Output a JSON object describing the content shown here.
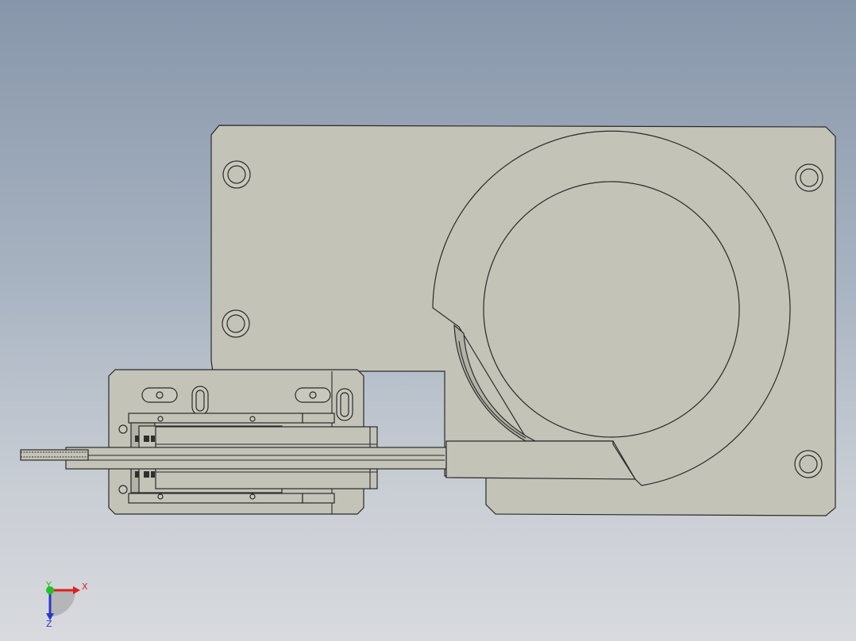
{
  "view_triad": {
    "x_label": "X",
    "y_label": "Y",
    "z_label": "Z",
    "x_color": "#e0201b",
    "y_color": "#22c02a",
    "z_color": "#2a38c8"
  },
  "colors": {
    "background_top": "#8796aa",
    "background_bottom": "#d8dade",
    "part_fill": "#c4c3b8",
    "edge_line": "#2a2a2a"
  }
}
